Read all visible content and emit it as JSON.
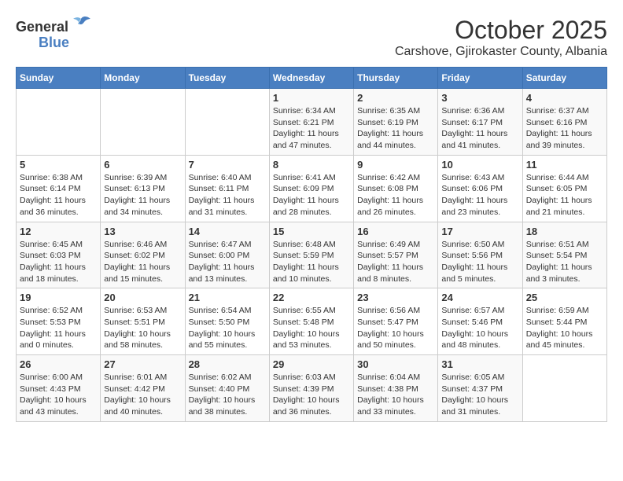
{
  "logo": {
    "general": "General",
    "blue": "Blue"
  },
  "title": "October 2025",
  "location": "Carshove, Gjirokaster County, Albania",
  "days_of_week": [
    "Sunday",
    "Monday",
    "Tuesday",
    "Wednesday",
    "Thursday",
    "Friday",
    "Saturday"
  ],
  "weeks": [
    [
      {
        "day": "",
        "info": ""
      },
      {
        "day": "",
        "info": ""
      },
      {
        "day": "",
        "info": ""
      },
      {
        "day": "1",
        "info": "Sunrise: 6:34 AM\nSunset: 6:21 PM\nDaylight: 11 hours and 47 minutes."
      },
      {
        "day": "2",
        "info": "Sunrise: 6:35 AM\nSunset: 6:19 PM\nDaylight: 11 hours and 44 minutes."
      },
      {
        "day": "3",
        "info": "Sunrise: 6:36 AM\nSunset: 6:17 PM\nDaylight: 11 hours and 41 minutes."
      },
      {
        "day": "4",
        "info": "Sunrise: 6:37 AM\nSunset: 6:16 PM\nDaylight: 11 hours and 39 minutes."
      }
    ],
    [
      {
        "day": "5",
        "info": "Sunrise: 6:38 AM\nSunset: 6:14 PM\nDaylight: 11 hours and 36 minutes."
      },
      {
        "day": "6",
        "info": "Sunrise: 6:39 AM\nSunset: 6:13 PM\nDaylight: 11 hours and 34 minutes."
      },
      {
        "day": "7",
        "info": "Sunrise: 6:40 AM\nSunset: 6:11 PM\nDaylight: 11 hours and 31 minutes."
      },
      {
        "day": "8",
        "info": "Sunrise: 6:41 AM\nSunset: 6:09 PM\nDaylight: 11 hours and 28 minutes."
      },
      {
        "day": "9",
        "info": "Sunrise: 6:42 AM\nSunset: 6:08 PM\nDaylight: 11 hours and 26 minutes."
      },
      {
        "day": "10",
        "info": "Sunrise: 6:43 AM\nSunset: 6:06 PM\nDaylight: 11 hours and 23 minutes."
      },
      {
        "day": "11",
        "info": "Sunrise: 6:44 AM\nSunset: 6:05 PM\nDaylight: 11 hours and 21 minutes."
      }
    ],
    [
      {
        "day": "12",
        "info": "Sunrise: 6:45 AM\nSunset: 6:03 PM\nDaylight: 11 hours and 18 minutes."
      },
      {
        "day": "13",
        "info": "Sunrise: 6:46 AM\nSunset: 6:02 PM\nDaylight: 11 hours and 15 minutes."
      },
      {
        "day": "14",
        "info": "Sunrise: 6:47 AM\nSunset: 6:00 PM\nDaylight: 11 hours and 13 minutes."
      },
      {
        "day": "15",
        "info": "Sunrise: 6:48 AM\nSunset: 5:59 PM\nDaylight: 11 hours and 10 minutes."
      },
      {
        "day": "16",
        "info": "Sunrise: 6:49 AM\nSunset: 5:57 PM\nDaylight: 11 hours and 8 minutes."
      },
      {
        "day": "17",
        "info": "Sunrise: 6:50 AM\nSunset: 5:56 PM\nDaylight: 11 hours and 5 minutes."
      },
      {
        "day": "18",
        "info": "Sunrise: 6:51 AM\nSunset: 5:54 PM\nDaylight: 11 hours and 3 minutes."
      }
    ],
    [
      {
        "day": "19",
        "info": "Sunrise: 6:52 AM\nSunset: 5:53 PM\nDaylight: 11 hours and 0 minutes."
      },
      {
        "day": "20",
        "info": "Sunrise: 6:53 AM\nSunset: 5:51 PM\nDaylight: 10 hours and 58 minutes."
      },
      {
        "day": "21",
        "info": "Sunrise: 6:54 AM\nSunset: 5:50 PM\nDaylight: 10 hours and 55 minutes."
      },
      {
        "day": "22",
        "info": "Sunrise: 6:55 AM\nSunset: 5:48 PM\nDaylight: 10 hours and 53 minutes."
      },
      {
        "day": "23",
        "info": "Sunrise: 6:56 AM\nSunset: 5:47 PM\nDaylight: 10 hours and 50 minutes."
      },
      {
        "day": "24",
        "info": "Sunrise: 6:57 AM\nSunset: 5:46 PM\nDaylight: 10 hours and 48 minutes."
      },
      {
        "day": "25",
        "info": "Sunrise: 6:59 AM\nSunset: 5:44 PM\nDaylight: 10 hours and 45 minutes."
      }
    ],
    [
      {
        "day": "26",
        "info": "Sunrise: 6:00 AM\nSunset: 4:43 PM\nDaylight: 10 hours and 43 minutes."
      },
      {
        "day": "27",
        "info": "Sunrise: 6:01 AM\nSunset: 4:42 PM\nDaylight: 10 hours and 40 minutes."
      },
      {
        "day": "28",
        "info": "Sunrise: 6:02 AM\nSunset: 4:40 PM\nDaylight: 10 hours and 38 minutes."
      },
      {
        "day": "29",
        "info": "Sunrise: 6:03 AM\nSunset: 4:39 PM\nDaylight: 10 hours and 36 minutes."
      },
      {
        "day": "30",
        "info": "Sunrise: 6:04 AM\nSunset: 4:38 PM\nDaylight: 10 hours and 33 minutes."
      },
      {
        "day": "31",
        "info": "Sunrise: 6:05 AM\nSunset: 4:37 PM\nDaylight: 10 hours and 31 minutes."
      },
      {
        "day": "",
        "info": ""
      }
    ]
  ]
}
